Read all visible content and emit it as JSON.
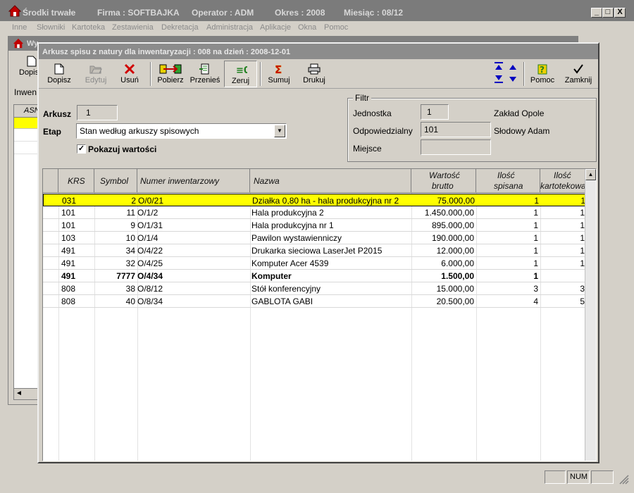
{
  "outer": {
    "app_title": "Środki trwałe",
    "firma": "Firma : SOFTBAJKA",
    "operator": "Operator : ADM",
    "okres": "Okres : 2008",
    "miesiac": "Miesiąc : 08/12",
    "btn_min": "_",
    "btn_max": "□",
    "btn_close": "X"
  },
  "menu": [
    "Inne",
    "Słowniki",
    "Kartoteka",
    "Zestawienia",
    "Dekretacja",
    "Administracja",
    "Aplikacje",
    "Okna",
    "Pomoc"
  ],
  "bg_window": {
    "title": "Wy",
    "tool_label": "Dopis",
    "tab_label": "Inwen",
    "grid_header": "ASN",
    "scroll_left": "◄"
  },
  "main": {
    "title": "Arkusz spisu z natury dla inwentaryzacji : 008 na dzień : 2008-12-01",
    "toolbar": {
      "dopisz": "Dopisz",
      "edytuj": "Edytuj",
      "usun": "Usuń",
      "pobierz": "Pobierz",
      "przenies": "Przenieś",
      "zeruj": "Zeruj",
      "sumuj": "Sumuj",
      "drukuj": "Drukuj",
      "pomoc": "Pomoc",
      "zamknij": "Zamknij"
    },
    "form": {
      "arkusz_label": "Arkusz",
      "arkusz_value": "1",
      "etap_label": "Etap",
      "etap_value": "Stan według arkuszy spisowych",
      "pokazuj_label": "Pokazuj wartości",
      "pokazuj_checked": true
    },
    "filtr": {
      "legend": "Filtr",
      "jednostka_label": "Jednostka",
      "jednostka_value": "1",
      "jednostka_name": "Zakład Opole",
      "odpowiedzialny_label": "Odpowiedzialny",
      "odpowiedzialny_value": "101",
      "odpowiedzialny_name": "Słodowy Adam",
      "miejsce_label": "Miejsce",
      "miejsce_value": ""
    },
    "grid": {
      "headers": {
        "krs": "KRS",
        "symbol": "Symbol",
        "numer": "Numer inwentarzowy",
        "nazwa": "Nazwa",
        "wartosc_1": "Wartość",
        "wartosc_2": "brutto",
        "spisana_1": "Ilość",
        "spisana_2": "spisana",
        "kartotekowa_1": "Ilość",
        "kartotekowa_2": "kartotekowa"
      },
      "rows": [
        {
          "krs": "031",
          "symbol": "2",
          "numer": "O/0/21",
          "nazwa": "Działka 0,80 ha - hala produkcyjna nr 2",
          "wartosc": "75.000,00",
          "spisana": "1",
          "kartotekowa": "1"
        },
        {
          "krs": "101",
          "symbol": "11",
          "numer": "O/1/2",
          "nazwa": "Hala produkcyjna 2",
          "wartosc": "1.450.000,00",
          "spisana": "1",
          "kartotekowa": "1"
        },
        {
          "krs": "101",
          "symbol": "9",
          "numer": "O/1/31",
          "nazwa": "Hala produkcyjna nr 1",
          "wartosc": "895.000,00",
          "spisana": "1",
          "kartotekowa": "1"
        },
        {
          "krs": "103",
          "symbol": "10",
          "numer": "O/1/4",
          "nazwa": "Pawilon wystawienniczy",
          "wartosc": "190.000,00",
          "spisana": "1",
          "kartotekowa": "1"
        },
        {
          "krs": "491",
          "symbol": "34",
          "numer": "O/4/22",
          "nazwa": "Drukarka sieciowa LaserJet P2015",
          "wartosc": "12.000,00",
          "spisana": "1",
          "kartotekowa": "1"
        },
        {
          "krs": "491",
          "symbol": "32",
          "numer": "O/4/25",
          "nazwa": "Komputer Acer 4539",
          "wartosc": "6.000,00",
          "spisana": "1",
          "kartotekowa": "1"
        },
        {
          "krs": "491",
          "symbol": "7777",
          "numer": "O/4/34",
          "nazwa": "Komputer",
          "wartosc": "1.500,00",
          "spisana": "1",
          "kartotekowa": "",
          "bold": true
        },
        {
          "krs": "808",
          "symbol": "38",
          "numer": "O/8/12",
          "nazwa": "Stół konferencyjny",
          "wartosc": "15.000,00",
          "spisana": "3",
          "kartotekowa": "3"
        },
        {
          "krs": "808",
          "symbol": "40",
          "numer": "O/8/34",
          "nazwa": "GABLOTA  GABI",
          "wartosc": "20.500,00",
          "spisana": "4",
          "kartotekowa": "5"
        }
      ],
      "selected_row": 0
    }
  },
  "statusbar": {
    "num": "NUM"
  },
  "colors": {
    "selection": "#ffff00",
    "title_inactive": "#8c8c8c",
    "face": "#d4d0c8"
  }
}
